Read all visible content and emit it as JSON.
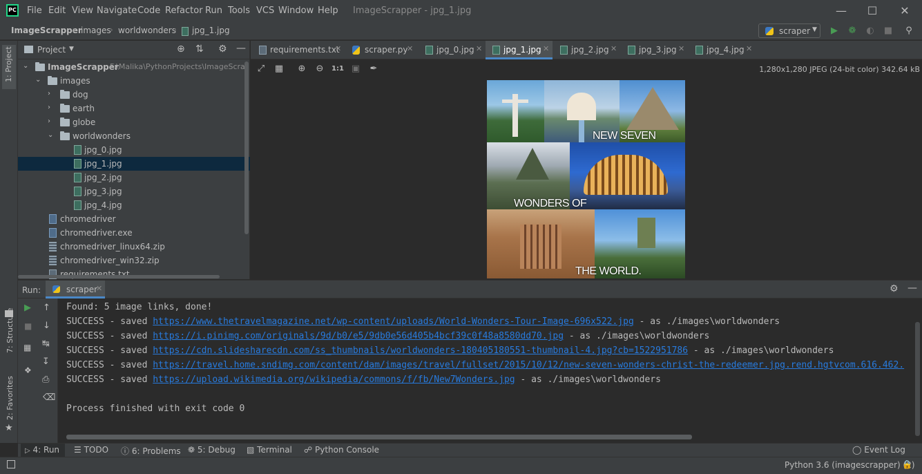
{
  "menubar": {
    "logo": "PC",
    "items": [
      "File",
      "Edit",
      "View",
      "Navigate",
      "Code",
      "Refactor",
      "Run",
      "Tools",
      "VCS",
      "Window",
      "Help"
    ],
    "window_title": "ImageScrapper - jpg_1.jpg",
    "minimize_icon": "minimize-icon",
    "maximize_icon": "maximize-icon",
    "close_icon": "close-icon"
  },
  "breadcrumb": [
    "ImageScrapper",
    "images",
    "worldwonders",
    "jpg_1.jpg"
  ],
  "run_config": {
    "label": "scraper"
  },
  "left_strip": {
    "project_label": "1: Project",
    "structure_label": "7: Structure",
    "favorites_label": "2: Favorites"
  },
  "project": {
    "title": "Project",
    "root_name": "ImageScrapper",
    "root_path": "F:\\Malika\\PythonProjects\\ImageScrap",
    "tree": [
      {
        "label": "images",
        "type": "folder",
        "depth": 1,
        "expanded": true
      },
      {
        "label": "dog",
        "type": "folder",
        "depth": 2,
        "expanded": false
      },
      {
        "label": "earth",
        "type": "folder",
        "depth": 2,
        "expanded": false
      },
      {
        "label": "globe",
        "type": "folder",
        "depth": 2,
        "expanded": false
      },
      {
        "label": "worldwonders",
        "type": "folder",
        "depth": 2,
        "expanded": true
      },
      {
        "label": "jpg_0.jpg",
        "type": "image",
        "depth": 3
      },
      {
        "label": "jpg_1.jpg",
        "type": "image",
        "depth": 3,
        "selected": true
      },
      {
        "label": "jpg_2.jpg",
        "type": "image",
        "depth": 3
      },
      {
        "label": "jpg_3.jpg",
        "type": "image",
        "depth": 3
      },
      {
        "label": "jpg_4.jpg",
        "type": "image",
        "depth": 3
      },
      {
        "label": "chromedriver",
        "type": "generic",
        "depth": 1
      },
      {
        "label": "chromedriver.exe",
        "type": "generic",
        "depth": 1
      },
      {
        "label": "chromedriver_linux64.zip",
        "type": "zip",
        "depth": 1
      },
      {
        "label": "chromedriver_win32.zip",
        "type": "zip",
        "depth": 1
      },
      {
        "label": "requirements.txt",
        "type": "text",
        "depth": 1
      }
    ]
  },
  "tabs": [
    {
      "label": "requirements.txt",
      "type": "text"
    },
    {
      "label": "scraper.py",
      "type": "python"
    },
    {
      "label": "jpg_0.jpg",
      "type": "image"
    },
    {
      "label": "jpg_1.jpg",
      "type": "image",
      "active": true
    },
    {
      "label": "jpg_2.jpg",
      "type": "image"
    },
    {
      "label": "jpg_3.jpg",
      "type": "image"
    },
    {
      "label": "jpg_4.jpg",
      "type": "image"
    }
  ],
  "image_viewer": {
    "info": "1,280x1,280 JPEG (24-bit color) 342.64 kB",
    "zoom_actual": "1:1",
    "overlay_line1": "NEW SEVEN",
    "overlay_line2": "WONDERS OF",
    "overlay_line3": "THE WORLD."
  },
  "run_panel": {
    "label": "Run:",
    "tab": "scraper",
    "lines": [
      {
        "prefix": "Found: 5 image links, done!",
        "url": "",
        "suffix": ""
      },
      {
        "prefix": "SUCCESS - saved ",
        "url": "https://www.thetravelmagazine.net/wp-content/uploads/World-Wonders-Tour-Image-696x522.jpg",
        "suffix": " - as ./images\\worldwonders"
      },
      {
        "prefix": "SUCCESS - saved ",
        "url": "https://i.pinimg.com/originals/9d/b0/e5/9db0e56d405b4bcf39c0f48a8580dd70.jpg",
        "suffix": " - as ./images\\worldwonders"
      },
      {
        "prefix": "SUCCESS - saved ",
        "url": "https://cdn.slidesharecdn.com/ss_thumbnails/worldwonders-180405180551-thumbnail-4.jpg?cb=1522951786",
        "suffix": " - as ./images\\worldwonders"
      },
      {
        "prefix": "SUCCESS - saved ",
        "url": "https://travel.home.sndimg.com/content/dam/images/travel/fullset/2015/10/12/new-seven-wonders-christ-the-redeemer.jpg.rend.hgtvcom.616.462.",
        "suffix": ""
      },
      {
        "prefix": "SUCCESS - saved ",
        "url": "https://upload.wikimedia.org/wikipedia/commons/f/fb/New7Wonders.jpg",
        "suffix": " - as ./images\\worldwonders"
      },
      {
        "prefix": "",
        "url": "",
        "suffix": ""
      },
      {
        "prefix": "Process finished with exit code 0",
        "url": "",
        "suffix": ""
      }
    ]
  },
  "bottom_tabs": [
    {
      "label": "4: Run",
      "icon": "play-icon",
      "active": true
    },
    {
      "label": "TODO",
      "icon": "list-icon"
    },
    {
      "label": "6: Problems",
      "icon": "info-icon"
    },
    {
      "label": "5: Debug",
      "icon": "bug-icon"
    },
    {
      "label": "Terminal",
      "icon": "terminal-icon"
    },
    {
      "label": "Python Console",
      "icon": "python-icon"
    }
  ],
  "event_log": "Event Log",
  "status": {
    "interpreter": "Python 3.6 (imagescrapper) (2)"
  },
  "colors": {
    "accent": "#4a88c7",
    "link": "#287bde",
    "run_green": "#499c54",
    "selection": "#0d293e"
  }
}
